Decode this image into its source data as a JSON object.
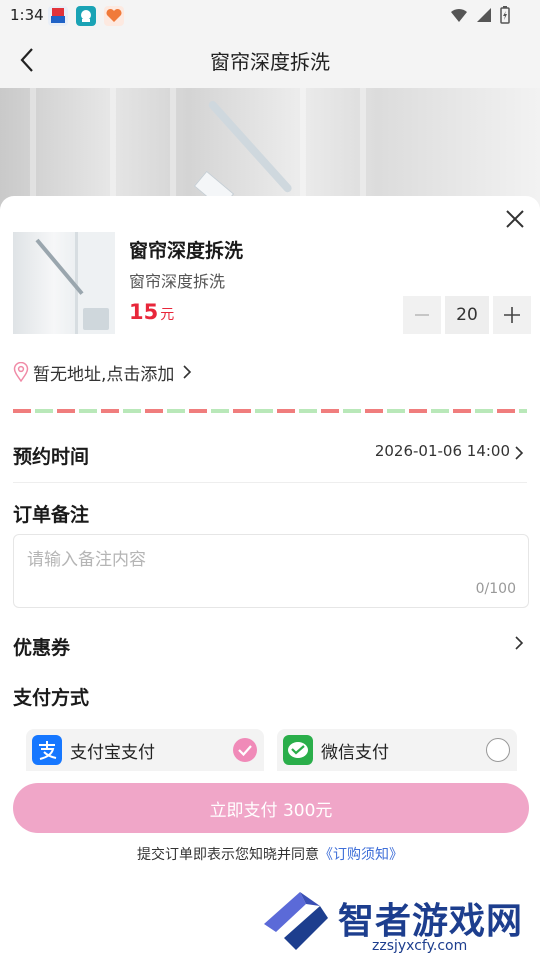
{
  "status_bar": {
    "time": "1:34",
    "icons": [
      "app-icon-1",
      "app-icon-2",
      "app-icon-3",
      "wifi-icon",
      "signal-icon",
      "battery-icon"
    ]
  },
  "nav": {
    "title": "窗帘深度拆洗",
    "back_icon": "chevron-left-icon"
  },
  "product": {
    "title": "窗帘深度拆洗",
    "subtitle": "窗帘深度拆洗",
    "price": "15",
    "price_unit": "元",
    "quantity": "20",
    "minus_icon": "minus-icon",
    "plus_icon": "plus-icon"
  },
  "address": {
    "text": "暂无地址,点击添加",
    "icon": "location-pin-icon"
  },
  "booking": {
    "label": "预约时间",
    "value": "2026-01-06 14:00"
  },
  "remark": {
    "label": "订单备注",
    "placeholder": "请输入备注内容",
    "count": "0/100"
  },
  "coupon": {
    "label": "优惠券"
  },
  "payment": {
    "label": "支付方式",
    "options": [
      {
        "label": "支付宝支付",
        "icon": "alipay-icon",
        "selected": true
      },
      {
        "label": "微信支付",
        "icon": "wechat-icon",
        "selected": false
      }
    ]
  },
  "submit": {
    "label": "立即支付 300元"
  },
  "agreement": {
    "text": "提交订单即表示您知晓并同意",
    "link": "《订购须知》"
  },
  "watermark": {
    "text": "智者游戏网",
    "url": "zzsjyxcfy.com"
  },
  "colors": {
    "accent": "#e8263a",
    "button": "#f0a6c8",
    "link": "#3f6fd8",
    "alipay": "#1677ff",
    "wechat": "#2aae4a"
  }
}
